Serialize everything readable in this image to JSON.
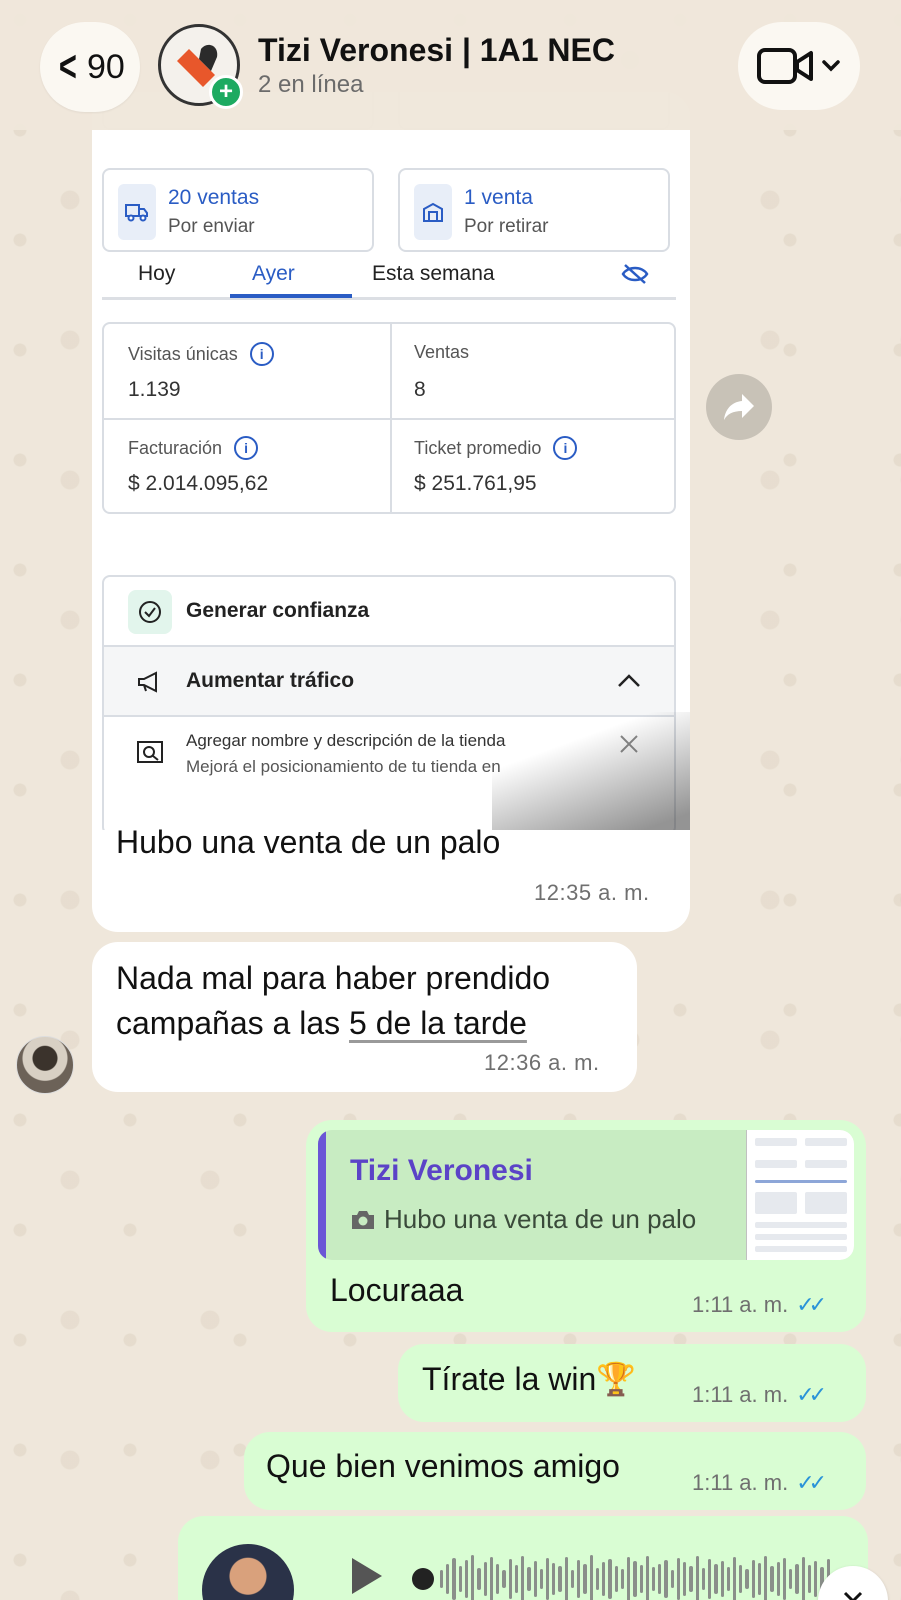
{
  "header": {
    "back_count": "90",
    "title": "Tizi Veronesi | 1A1 NEC",
    "subtitle": "2 en línea"
  },
  "screenshot": {
    "card_sales_to_ship_title": "20 ventas",
    "card_sales_to_ship_sub": "Por enviar",
    "card_sales_pickup_title": "1 venta",
    "card_sales_pickup_sub": "Por retirar",
    "tabs": [
      "Hoy",
      "Ayer",
      "Esta semana"
    ],
    "active_tab": "Ayer",
    "stats": {
      "unique_visits_label": "Visitas únicas",
      "unique_visits_value": "1.139",
      "sales_label": "Ventas",
      "sales_value": "8",
      "billing_label": "Facturación",
      "billing_value": "$ 2.014.095,62",
      "avg_ticket_label": "Ticket promedio",
      "avg_ticket_value": "$ 251.761,95"
    },
    "tips": {
      "trust_title": "Generar confianza",
      "traffic_title": "Aumentar tráfico",
      "store_name_title": "Agregar nombre y descripción de la tienda",
      "store_name_desc": "Mejorá el posicionamiento de tu tienda en"
    }
  },
  "messages": {
    "img_caption": "Hubo una venta de un palo",
    "img_time": "12:35 a. m.",
    "in_text_part1": "Nada mal para haber prendido campañas a las ",
    "in_text_underlined": "5 de la tarde",
    "in_time": "12:36 a. m.",
    "reply_quote_name": "Tizi Veronesi",
    "reply_quote_text": "Hubo una venta de un palo",
    "out1_text": "Locuraaa",
    "out1_time": "1:11 a. m.",
    "out2_text": "Tírate la win🏆",
    "out2_time": "1:11 a. m.",
    "out3_text": "Que bien venimos amigo",
    "out3_time": "1:11 a. m."
  },
  "colors": {
    "outgoing_bubble": "#d9fdd3",
    "incoming_bubble": "#ffffff",
    "read_ticks": "#2a93d8",
    "quote_name": "#5b43c7",
    "link_blue": "#2a5cc4"
  },
  "icons": [
    "chevron-left-icon",
    "video-call-icon",
    "chevron-down-icon",
    "forward-icon",
    "camera-icon",
    "double-check-icon",
    "play-icon",
    "close-icon",
    "truck-icon",
    "store-icon",
    "eye-off-icon",
    "info-icon",
    "check-circle-icon",
    "megaphone-icon",
    "chevron-up-icon",
    "search-store-icon"
  ]
}
